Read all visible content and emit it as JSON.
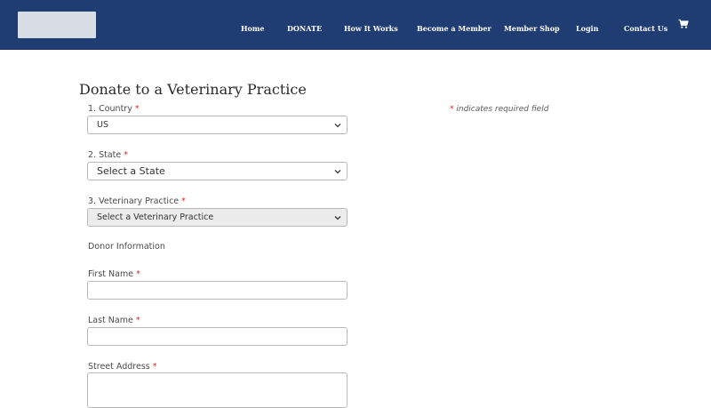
{
  "header": {
    "nav": [
      "Home",
      "DONATE",
      "How It Works",
      "Become a Member",
      "Member Shop",
      "Login",
      "Contact Us"
    ],
    "cart_icon": "shopping-cart-icon"
  },
  "page": {
    "title": "Donate to a Veterinary Practice",
    "required_note": "indicates required field",
    "required_marker": "*"
  },
  "form": {
    "country": {
      "label": "1. Country",
      "value": "US"
    },
    "state": {
      "label": "2. State",
      "value": "Select a State"
    },
    "practice": {
      "label": "3. Veterinary Practice",
      "value": "Select a Veterinary Practice"
    },
    "section_heading": "Donor Information",
    "first_name": {
      "label": "First Name",
      "value": ""
    },
    "last_name": {
      "label": "Last Name",
      "value": ""
    },
    "street_address": {
      "label": "Street Address",
      "value": ""
    }
  },
  "colors": {
    "header_bg": "#1f3c73",
    "required": "#cc2b2b"
  }
}
